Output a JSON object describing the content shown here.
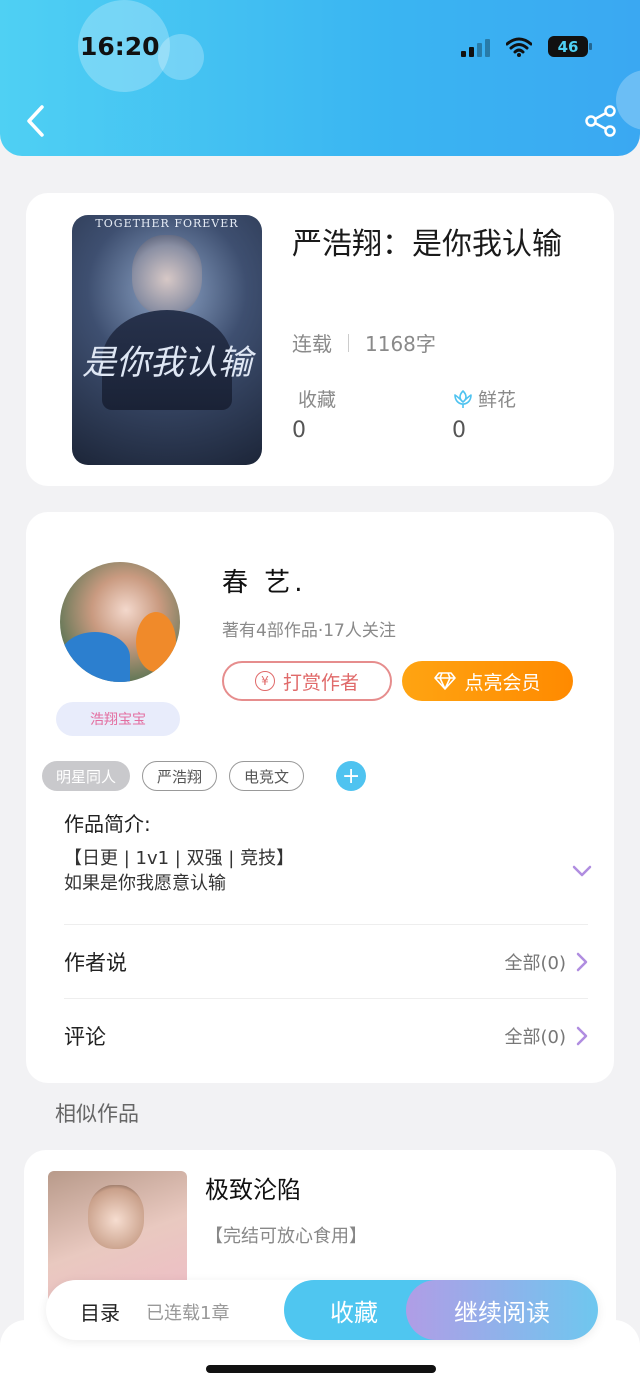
{
  "status_bar": {
    "time": "16:20",
    "battery": "46"
  },
  "book": {
    "cover_top_text": "TOGETHER FOREVER",
    "cover_title": "是你我认输",
    "title": "严浩翔：是你我认输",
    "status": "连载",
    "word_count": "1168字",
    "favorites_label": "收藏",
    "favorites_count": "0",
    "flowers_label": "鲜花",
    "flowers_count": "0"
  },
  "author": {
    "name": "春 艺.",
    "meta": "著有4部作品·17人关注",
    "fan_badge": "浩翔宝宝",
    "tip_label": "打赏作者",
    "vip_label": "点亮会员"
  },
  "tags": [
    "明星同人",
    "严浩翔",
    "电竞文"
  ],
  "intro": {
    "label": "作品简介:",
    "line1": "【日更 | 1v1 | 双强 | 竞技】",
    "line2": "如果是你我愿意认输"
  },
  "author_says": {
    "label": "作者说",
    "count_label": "全部(0)"
  },
  "comments": {
    "label": "评论",
    "count_label": "全部(0)"
  },
  "similar": {
    "section_title": "相似作品",
    "items": [
      {
        "title": "极致沦陷",
        "desc": "【完结可放心食用】"
      }
    ]
  },
  "bottom": {
    "toc_label": "目录",
    "chapters_label": "已连载1章",
    "favorite_button": "收藏",
    "read_button": "继续阅读"
  },
  "colors": {
    "header_start": "#4fd0f3",
    "header_end": "#3aa8f2",
    "vip_orange": "#ff9a0a",
    "tip_red": "#e06a6a",
    "accent_blue": "#4fc6f0",
    "accent_purple": "#b09de6"
  }
}
